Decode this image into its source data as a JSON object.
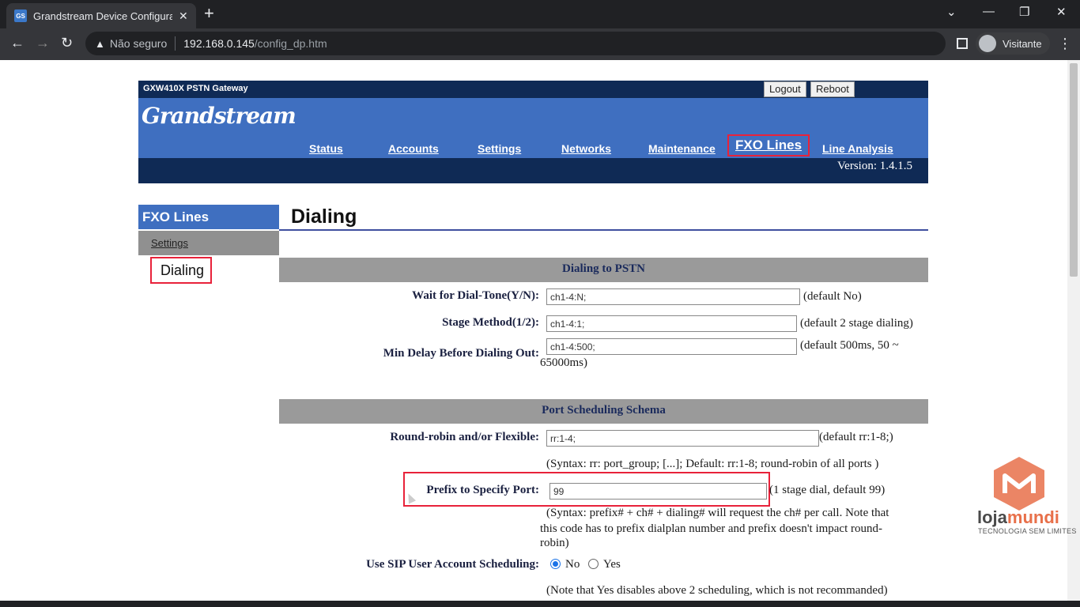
{
  "browser": {
    "tab_title": "Grandstream Device Configuratio",
    "favicon": "GS",
    "insecure_label": "Não seguro",
    "url_host": "192.168.0.145",
    "url_path": "/config_dp.htm",
    "profile_name": "Visitante"
  },
  "header": {
    "product": "GXW410X PSTN Gateway",
    "logout": "Logout",
    "reboot": "Reboot",
    "logo": "Grandstream",
    "version": "Version: 1.4.1.5",
    "nav": [
      "Status",
      "Accounts",
      "Settings",
      "Networks",
      "Maintenance",
      "FXO Lines",
      "Line Analysis"
    ]
  },
  "sidebar": {
    "title": "FXO Lines",
    "settings": "Settings",
    "dialing": "Dialing"
  },
  "main": {
    "title": "Dialing",
    "sections": {
      "pstn": "Dialing to PSTN",
      "schema": "Port Scheduling Schema"
    },
    "fields": {
      "wait_label": "Wait for Dial-Tone(Y/N):",
      "wait_value": "ch1-4:N;",
      "wait_note": "(default No)",
      "stage_label": "Stage Method(1/2):",
      "stage_value": "ch1-4:1;",
      "stage_note": "(default 2 stage dialing)",
      "delay_label": "Min Delay Before Dialing Out:",
      "delay_value": "ch1-4:500;",
      "delay_note1": "(default 500ms, 50 ~",
      "delay_note2": "65000ms)",
      "rr_label": "Round-robin and/or Flexible:",
      "rr_value": "rr:1-4;",
      "rr_note": "(default rr:1-8;)",
      "rr_syntax": "(Syntax: rr: port_group; [...]; Default: rr:1-8; round-robin of all ports )",
      "prefix_label": "Prefix to Specify Port:",
      "prefix_value": "99",
      "prefix_note": "(1 stage dial, default 99)",
      "prefix_syntax1": "(Syntax: prefix# + ch# + dialing# will request the ch# per call. Note that",
      "prefix_syntax2": "this code has to prefix dialplan number and prefix doesn't impact round-",
      "prefix_syntax3": "robin)",
      "sip_label": "Use SIP User Account Scheduling:",
      "sip_no": "No",
      "sip_yes": "Yes",
      "sip_selected": "No",
      "sip_note": "(Note that Yes disables above 2 scheduling, which is not recommanded)"
    }
  },
  "watermark": {
    "brand_a": "loja",
    "brand_b": "mundi",
    "tagline": "TECNOLOGIA SEM LIMITES",
    "accent": "#e8704a"
  }
}
